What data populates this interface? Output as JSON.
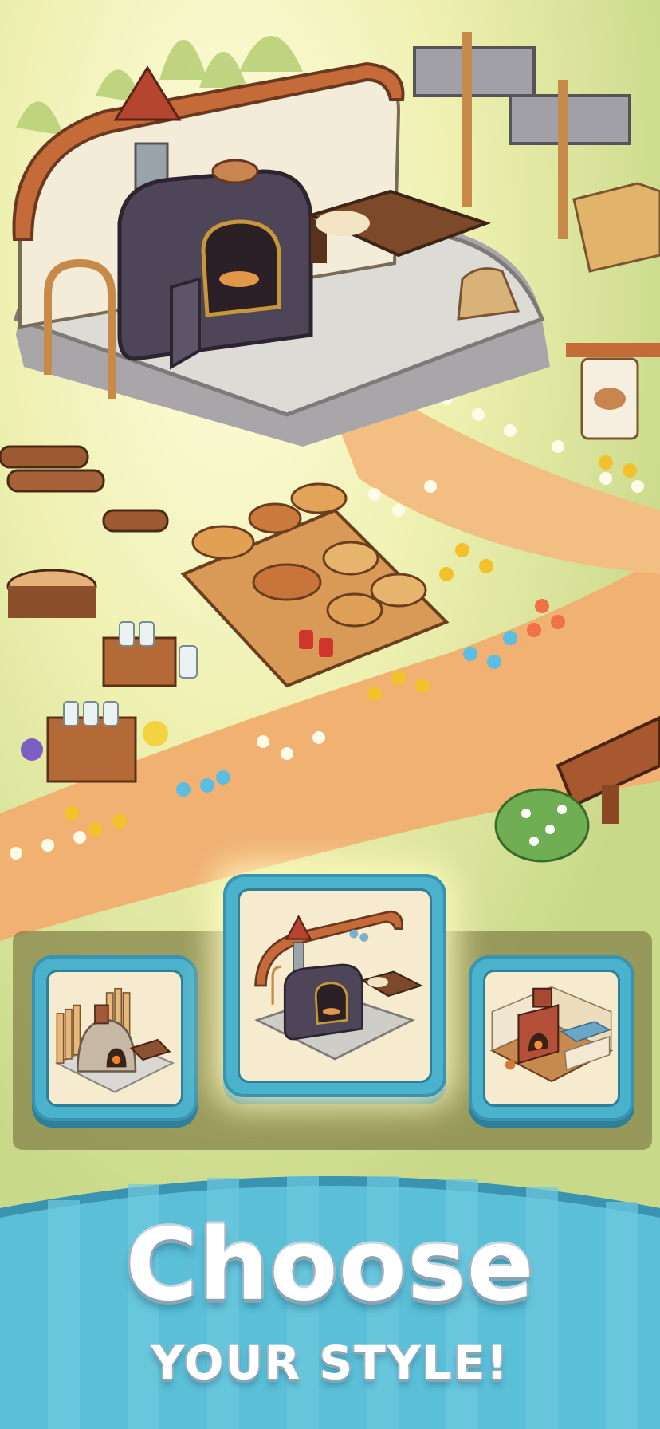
{
  "headline": {
    "title": "Choose",
    "subtitle": "YOUR STYLE!"
  },
  "style_options": [
    {
      "name": "stone-clay-oven",
      "selected": false
    },
    {
      "name": "iron-stove-oven",
      "selected": true
    },
    {
      "name": "brick-fireplace-oven",
      "selected": false
    }
  ],
  "colors": {
    "banner": "#5bbfd8",
    "card_border": "#3a93b0",
    "card_fill": "#f6ebcf",
    "grass": "#d9e39a",
    "path": "#f0b173"
  }
}
